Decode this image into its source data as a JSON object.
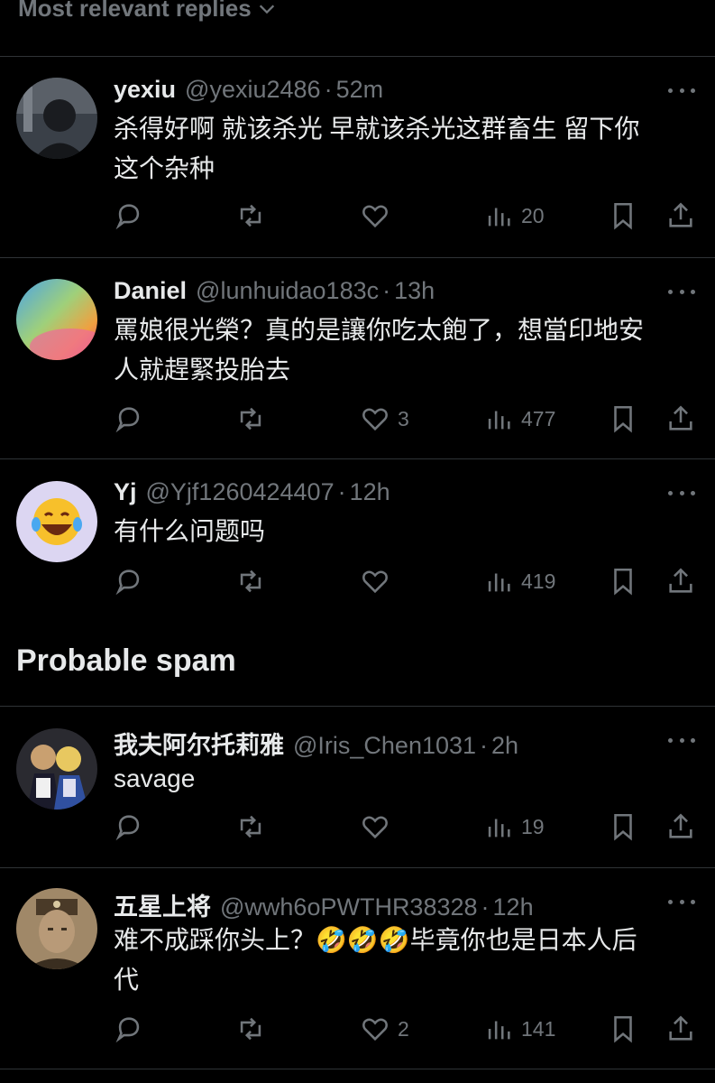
{
  "sort": {
    "label": "Most relevant replies"
  },
  "replies": [
    {
      "name": "yexiu",
      "handle": "@yexiu2486",
      "sep": "·",
      "time": "52m",
      "text_lines": [
        "杀得好啊 就该杀光 早就该杀光这群畜生 留下你",
        "这个杂种"
      ],
      "likes": "",
      "views": "20",
      "avatar": "dark-anime-avatar"
    },
    {
      "name": "Daniel",
      "handle": "@lunhuidao183c",
      "sep": "·",
      "time": "13h",
      "text_lines": [
        "罵娘很光榮？真的是讓你吃太飽了，想當印地安",
        "人就趕緊投胎去"
      ],
      "likes": "3",
      "views": "477",
      "avatar": "gradient-orb-avatar"
    },
    {
      "name": "Yj",
      "handle": "@Yjf1260424407",
      "sep": "·",
      "time": "12h",
      "text_lines": [
        "有什么问题吗"
      ],
      "likes": "",
      "views": "419",
      "avatar": "laughing-face-avatar"
    }
  ],
  "section": {
    "title": "Probable spam"
  },
  "spam_replies": [
    {
      "name": "我夫阿尔托莉雅",
      "handle": "@Iris_Chen1031",
      "sep": "·",
      "time": "2h",
      "text_lines": [
        "savage"
      ],
      "likes": "",
      "views": "19",
      "avatar": "anime-duo-avatar"
    },
    {
      "name": "五星上将",
      "handle": "@wwh6oPWTHR38328",
      "sep": "·",
      "time": "12h",
      "text_lines": [
        "难不成踩你头上？🤣🤣🤣毕竟你也是日本人后",
        "代"
      ],
      "likes": "2",
      "views": "141",
      "avatar": "sepia-portrait-avatar"
    }
  ],
  "colors": {
    "background": "#000000",
    "text": "#e7e9ea",
    "muted": "#71767b",
    "divider": "#2f3336"
  },
  "icons": [
    "reply-icon",
    "retweet-icon",
    "like-icon",
    "views-icon",
    "bookmark-icon",
    "share-icon",
    "more-icon",
    "chevron-down-icon"
  ]
}
